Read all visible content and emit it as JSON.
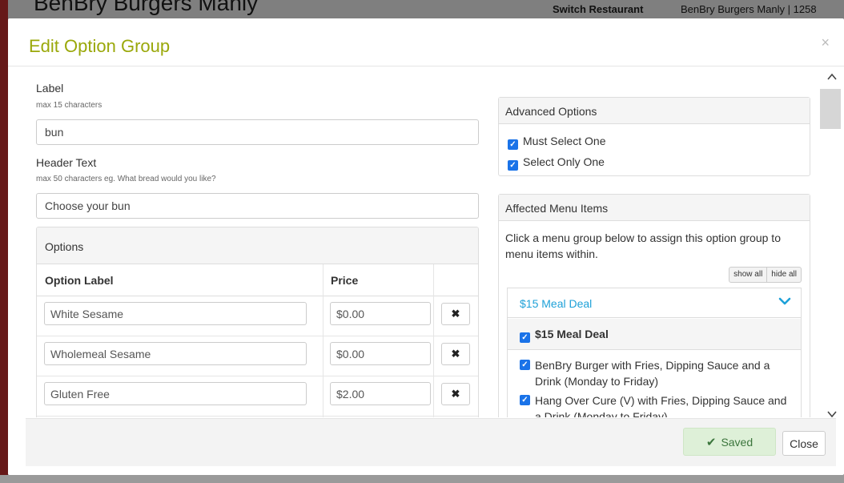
{
  "background": {
    "title": "BenBry Burgers Manly",
    "switch_restaurant": "Switch Restaurant",
    "restaurant_name": "BenBry Burgers Manly | 1258"
  },
  "modal": {
    "title": "Edit Option Group",
    "close_glyph": "×"
  },
  "form": {
    "label": {
      "label": "Label",
      "hint": "max 15 characters",
      "value": "bun"
    },
    "header_text": {
      "label": "Header Text",
      "hint": "max 50 characters eg. What bread would you like?",
      "value": "Choose your bun"
    }
  },
  "options": {
    "heading": "Options",
    "columns": {
      "label": "Option Label",
      "price": "Price"
    },
    "rows": [
      {
        "label": "White Sesame",
        "price": "$0.00",
        "remove_glyph": "✖"
      },
      {
        "label": "Wholemeal Sesame",
        "price": "$0.00",
        "remove_glyph": "✖"
      },
      {
        "label": "Gluten Free",
        "price": "$2.00",
        "remove_glyph": "✖"
      }
    ]
  },
  "advanced": {
    "heading": "Advanced Options",
    "items": [
      {
        "label": "Must Select One",
        "checked": true
      },
      {
        "label": "Select Only One",
        "checked": true
      }
    ]
  },
  "affected": {
    "heading": "Affected Menu Items",
    "description": "Click a menu group below to assign this option group to menu items within.",
    "show_all": "show all",
    "hide_all": "hide all",
    "group": {
      "title": "$15 Meal Deal",
      "select_all_label": "$15 Meal Deal",
      "items": [
        {
          "label": "BenBry Burger with Fries, Dipping Sauce and a Drink (Monday to Friday)",
          "checked": true
        },
        {
          "label": "Hang Over Cure (V) with Fries, Dipping Sauce and a Drink (Monday to Friday)",
          "checked": true
        }
      ]
    }
  },
  "footer": {
    "saved_label": "Saved",
    "close_label": "Close"
  },
  "colors": {
    "title_accent": "#9aa80a",
    "link": "#1ea1d8",
    "checkbox": "#1a73e8",
    "saved_bg": "#def0d8",
    "saved_text": "#3c763d"
  }
}
